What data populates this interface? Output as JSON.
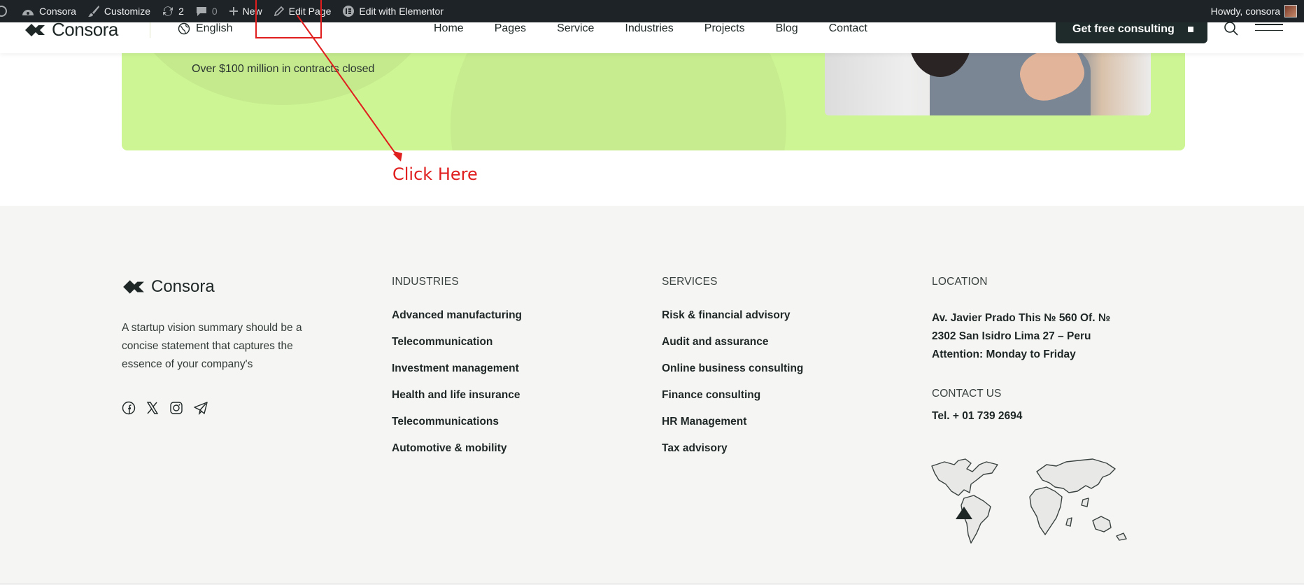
{
  "admin_bar": {
    "site_name": "Consora",
    "customize": "Customize",
    "updates_count": "2",
    "comments_count": "0",
    "new": "New",
    "edit_page": "Edit Page",
    "edit_elementor": "Edit with Elementor",
    "howdy": "Howdy, consora"
  },
  "header": {
    "logo": "Consora",
    "language": "English",
    "nav": [
      "Home",
      "Pages",
      "Service",
      "Industries",
      "Projects",
      "Blog",
      "Contact"
    ],
    "cta": "Get free consulting"
  },
  "hero": {
    "subtext": "Over $100 million in contracts closed"
  },
  "annotation": {
    "text": "Click Here",
    "color": "#e01e1e"
  },
  "footer": {
    "logo": "Consora",
    "description": "A startup vision summary should be a concise statement that captures the essence of your company's",
    "industries": {
      "heading": "INDUSTRIES",
      "items": [
        "Advanced manufacturing",
        "Telecommunication",
        "Investment management",
        "Health and life insurance",
        "Telecommunications",
        "Automotive & mobility"
      ]
    },
    "services": {
      "heading": "SERVICES",
      "items": [
        "Risk & financial advisory",
        "Audit and assurance",
        "Online business consulting",
        "Finance consulting",
        "HR Management",
        "Tax advisory"
      ]
    },
    "location": {
      "heading": "LOCATION",
      "lines": [
        "Av. Javier Prado This № 560 Of. №",
        "2302 San Isidro Lima 27 – Peru",
        "Attention: Monday to Friday"
      ],
      "contact_heading": "CONTACT US",
      "phone": "Tel. + 01 739 2694"
    },
    "socials": [
      "facebook-icon",
      "x-icon",
      "instagram-icon",
      "telegram-icon"
    ]
  },
  "colors": {
    "admin_bar": "#1d2327",
    "hero_green": "#cdf594",
    "dark": "#1e2b2a",
    "footer_bg": "#f5f5f3"
  }
}
